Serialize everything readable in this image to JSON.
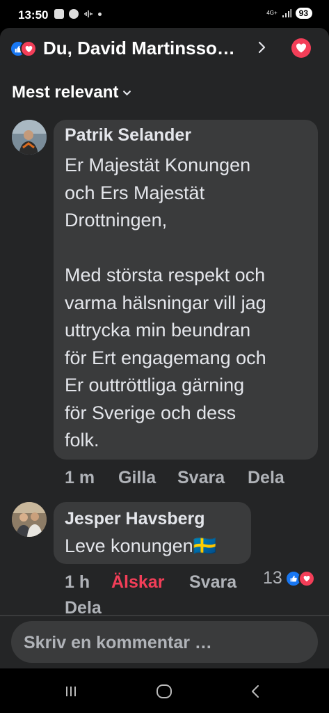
{
  "status_bar": {
    "time": "13:50",
    "network": "4G+",
    "battery": "93",
    "icons": [
      "gallery-icon",
      "facebook-icon",
      "sound-wave-icon",
      "dot-icon",
      "signal-icon"
    ]
  },
  "header": {
    "title": "Du, David Martinsso…",
    "reaction_icons": [
      "like-icon",
      "love-icon"
    ],
    "love_button_icon": "heart-icon"
  },
  "sort": {
    "label": "Mest relevant"
  },
  "comments": [
    {
      "author": "Patrik Selander",
      "text": "Er Majestät Konungen\noch Ers Majestät\nDrottningen,\n\nMed största respekt och\nvarma hälsningar vill jag\nuttrycka min beundran\nför Ert engagemang och\nEr outtröttliga gärning\nför Sverige och dess\nfolk.",
      "time": "1 m",
      "like": "Gilla",
      "reply": "Svara",
      "share": "Dela"
    },
    {
      "author": "Jesper Havsberg",
      "text": "Leve konungen",
      "flag": "🇸🇪",
      "time": "1 h",
      "like": "Älskar",
      "reply": "Svara",
      "share": "Dela",
      "reaction_count": "13"
    }
  ],
  "composer": {
    "placeholder": "Skriv en kommentar …"
  },
  "colors": {
    "panel": "#242526",
    "bubble": "#3a3b3c",
    "like_blue": "#1877f2",
    "love_red": "#f33e58",
    "secondary_text": "#b0b3b8"
  }
}
